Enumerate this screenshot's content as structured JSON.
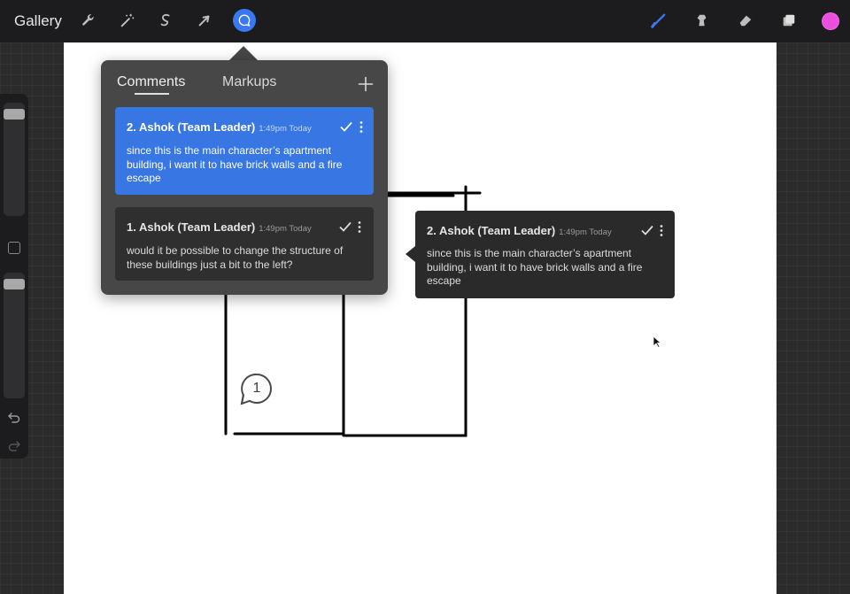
{
  "toolbar": {
    "gallery_label": "Gallery",
    "tools": [
      {
        "name": "actions",
        "icon": "wrench-icon"
      },
      {
        "name": "adjustments",
        "icon": "magic-wand-icon"
      },
      {
        "name": "selection",
        "icon": "selection-s-icon"
      },
      {
        "name": "transform",
        "icon": "arrow-cursor-icon"
      },
      {
        "name": "comments",
        "icon": "speech-bubble-icon",
        "active": true
      }
    ],
    "right_tools": [
      {
        "name": "brush",
        "icon": "brush-icon",
        "active": true
      },
      {
        "name": "smudge",
        "icon": "smudge-icon"
      },
      {
        "name": "eraser",
        "icon": "eraser-icon"
      },
      {
        "name": "layers",
        "icon": "layers-icon"
      }
    ],
    "current_color": "#ec4fe0",
    "accent_color": "#3a78f2"
  },
  "comments_panel": {
    "tabs": [
      {
        "label": "Comments",
        "active": true
      },
      {
        "label": "Markups",
        "active": false
      }
    ],
    "comments": [
      {
        "number_author": "2. Ashok (Team Leader)",
        "time": "1:49pm Today",
        "body": "since this is the main character’s apartment building, i want it to have brick walls and a fire escape",
        "selected": true
      },
      {
        "number_author": "1. Ashok (Team Leader)",
        "time": "1:49pm Today",
        "body": "would it be possible to change the structure of these buildings just a bit to the left?",
        "selected": false
      }
    ]
  },
  "popover": {
    "number_author": "2. Ashok (Team Leader)",
    "time": "1:49pm Today",
    "body": "since this is the main character’s apartment building, i want it to have brick walls and a fire escape"
  },
  "canvas_marker": {
    "number": "1"
  },
  "sidebar": {
    "icons": [
      "undo-icon",
      "redo-icon"
    ]
  }
}
